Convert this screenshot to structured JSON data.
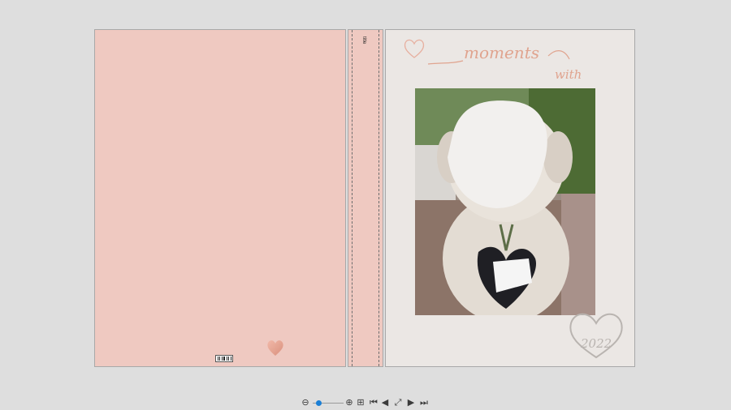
{
  "cover": {
    "spine_text": "title",
    "front_title": "moments",
    "front_subtitle": "with",
    "year": "2022"
  },
  "toolbar": {
    "zoom_level": 0.1,
    "icons": [
      "zoom-out-icon",
      "zoom-in-icon",
      "add-page-icon",
      "first-page-icon",
      "previous-page-icon",
      "fit-screen-icon",
      "next-page-icon",
      "last-page-icon"
    ]
  },
  "colors": {
    "cover_pink": "#efc9c1",
    "front_cream": "#ebe7e4",
    "script_accent": "#e0a48f",
    "slider_knob": "#1a7fd6"
  }
}
